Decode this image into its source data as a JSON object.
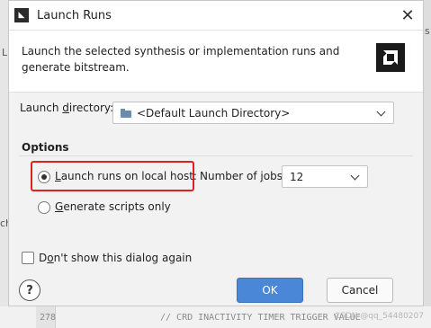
{
  "window": {
    "title": "Launch Runs",
    "close_glyph": "✕"
  },
  "header": {
    "description": "Launch the selected synthesis or implementation runs and generate bitstream."
  },
  "launch_directory": {
    "label_before": "Launch ",
    "label_mnemonic": "d",
    "label_after": "irectory:",
    "value": "<Default Launch Directory>"
  },
  "options": {
    "title": "Options",
    "local_host": {
      "mnemonic": "L",
      "label_rest": "aunch runs on local host:",
      "checked": true
    },
    "jobs": {
      "label_before": "Number of ",
      "label_mnemonic": "j",
      "label_after": "obs:",
      "value": "12"
    },
    "generate_scripts": {
      "mnemonic": "G",
      "label_rest": "enerate scripts only",
      "checked": false
    }
  },
  "dont_show": {
    "label_before": "D",
    "label_mnemonic": "o",
    "label_after": "n't show this dialog again",
    "checked": false
  },
  "buttons": {
    "help": "?",
    "ok": "OK",
    "cancel": "Cancel"
  },
  "background": {
    "line_number": "278",
    "code": "// CRD INACTIVITY TIMER TRIGGER VALUE",
    "left_fragment_1": "L",
    "left_fragment_2": "ch",
    "right_fragment": "s",
    "watermark": "CSDN @qq_54480207"
  },
  "colors": {
    "highlight_border": "#e0201f",
    "ok_button": "#4a87d6"
  }
}
